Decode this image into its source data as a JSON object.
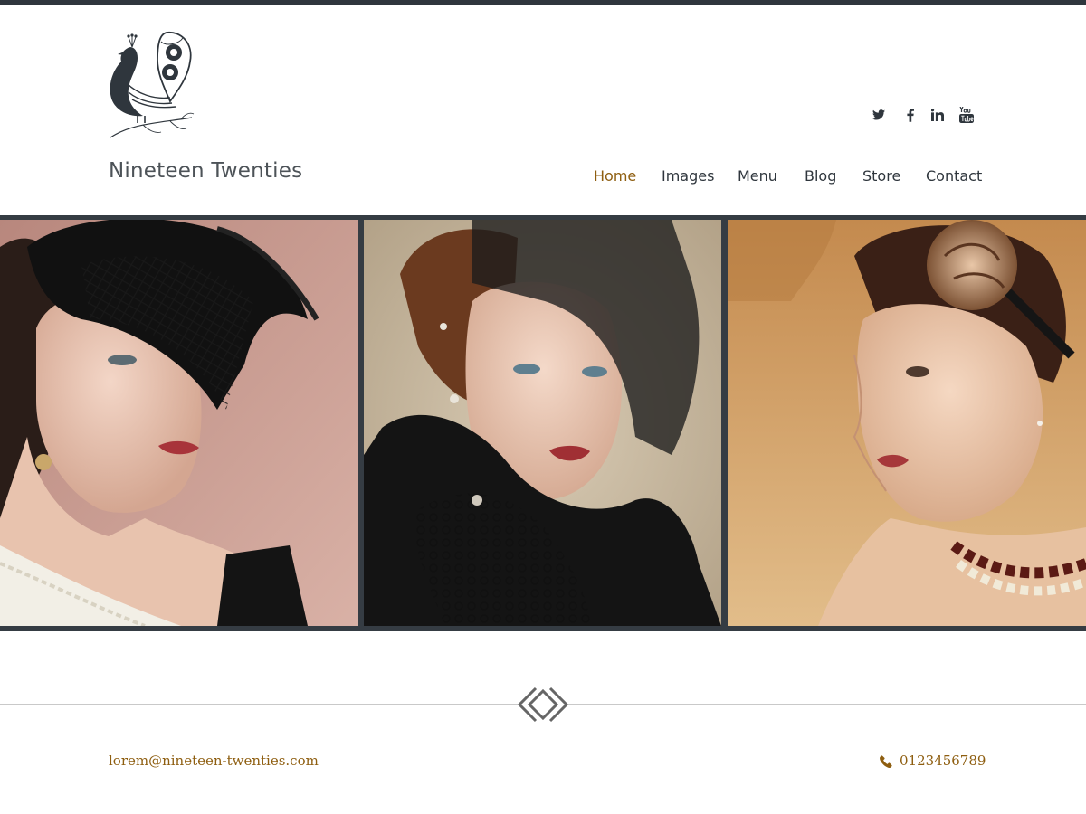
{
  "header": {
    "site_title": "Nineteen Twenties",
    "logo_icon": "peacock-icon"
  },
  "social": [
    {
      "name": "twitter",
      "icon": "twitter-icon"
    },
    {
      "name": "facebook",
      "icon": "facebook-icon"
    },
    {
      "name": "linkedin",
      "icon": "linkedin-icon"
    },
    {
      "name": "youtube",
      "icon": "youtube-icon"
    }
  ],
  "nav": {
    "active": "Home",
    "items": [
      "Home",
      "Images",
      "Menu",
      "Blog",
      "Store",
      "Contact"
    ]
  },
  "gallery": {
    "photos": [
      {
        "subject": "woman-black-net-fascinator"
      },
      {
        "subject": "woman-veil-fur-lace-glove"
      },
      {
        "subject": "woman-rose-headpiece-pearls"
      }
    ]
  },
  "divider_icon": "diamond-icon",
  "footer": {
    "email": "lorem@nineteen-twenties.com",
    "phone": "0123456789",
    "phone_icon": "phone-icon"
  },
  "colors": {
    "accent": "#8e5e10",
    "dark": "#2f363d",
    "gallery_border": "#353c43"
  }
}
